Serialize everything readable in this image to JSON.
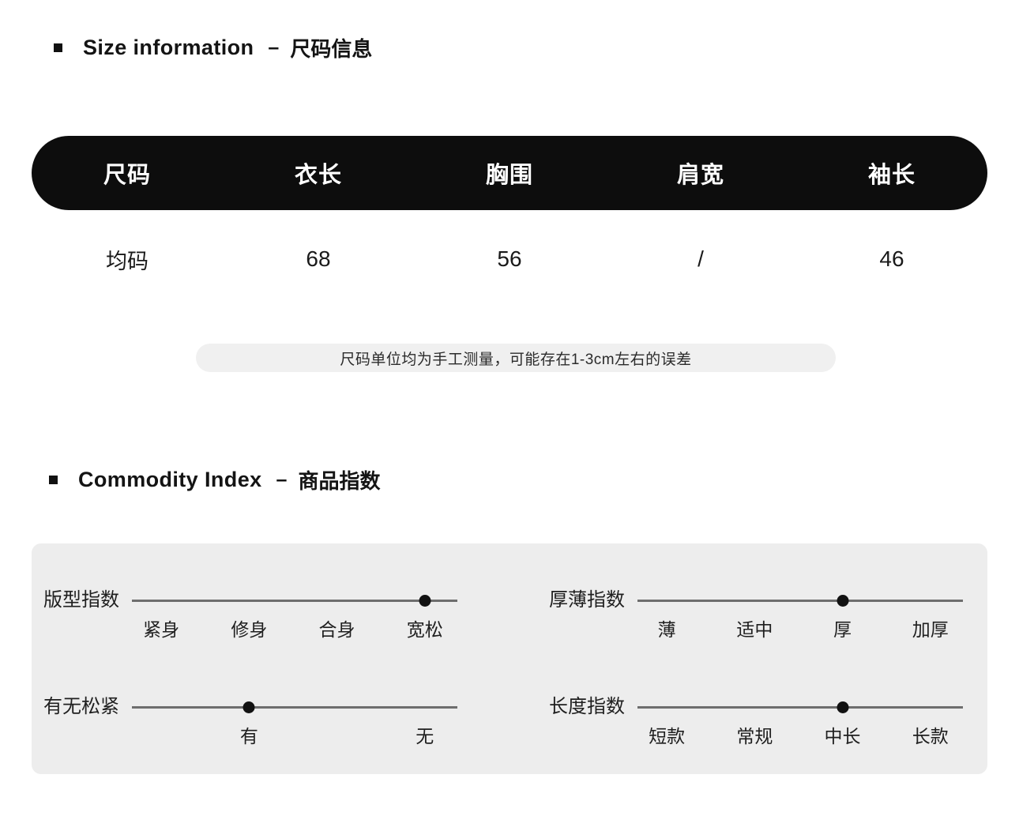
{
  "sections": [
    {
      "id": "size",
      "bullet": "square-bullet",
      "title_en": "Size information",
      "dash": "–",
      "title_cn": "尺码信息"
    },
    {
      "id": "commodity-index",
      "bullet": "square-bullet",
      "title_en": "Commodity Index",
      "dash": "–",
      "title_cn": "商品指数"
    }
  ],
  "size_table": {
    "headers": [
      "尺码",
      "衣长",
      "胸围",
      "肩宽",
      "袖长"
    ],
    "rows": [
      [
        "均码",
        "68",
        "56",
        "/",
        "46"
      ]
    ],
    "header_bg": "#0d0d0d",
    "header_text_color": "#ffffff"
  },
  "size_note": {
    "text": "尺码单位均为手工测量，可能存在1-3cm左右的误差",
    "background": "#f0f0f0"
  },
  "commodity_index": {
    "panel_background": "#ededed",
    "accent_color": "#121212",
    "track_color": "#6e6e6e",
    "sliders": [
      {
        "label": "版型指数",
        "options": [
          "紧身",
          "修身",
          "合身",
          "宽松"
        ],
        "selected_index": 3,
        "selected_value": "宽松"
      },
      {
        "label": "厚薄指数",
        "options": [
          "薄",
          "适中",
          "厚",
          "加厚"
        ],
        "selected_index": 2,
        "selected_value": "厚"
      },
      {
        "label": "有无松紧",
        "options": [
          "有",
          "无"
        ],
        "option_slots": [
          1,
          3
        ],
        "selected_index": 0,
        "selected_value": "有"
      },
      {
        "label": "长度指数",
        "options": [
          "短款",
          "常规",
          "中长",
          "长款"
        ],
        "selected_index": 2,
        "selected_value": "中长"
      }
    ]
  }
}
